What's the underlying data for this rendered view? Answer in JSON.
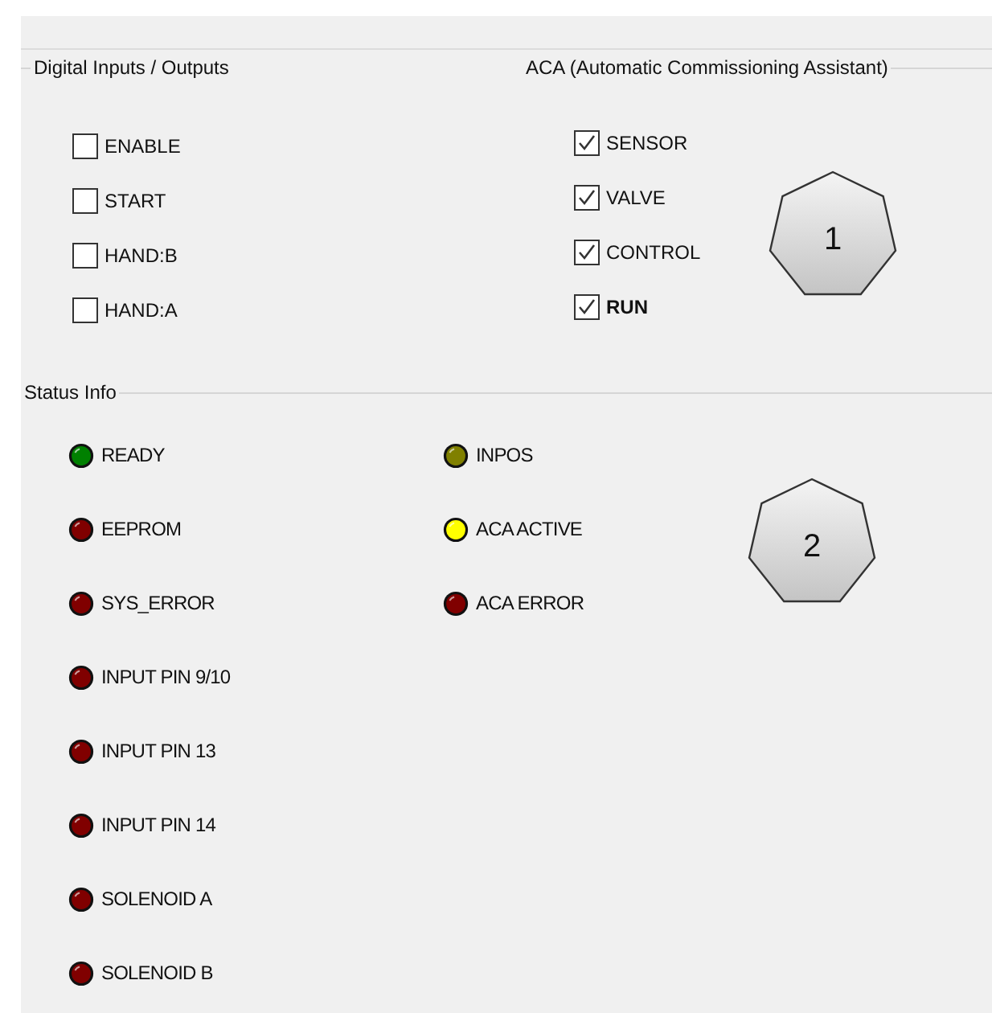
{
  "io_group": {
    "title": "Digital Inputs / Outputs",
    "items": [
      {
        "label": "ENABLE",
        "checked": false,
        "bold": false
      },
      {
        "label": "START",
        "checked": false,
        "bold": false
      },
      {
        "label": "HAND:B",
        "checked": false,
        "bold": false
      },
      {
        "label": "HAND:A",
        "checked": false,
        "bold": false
      }
    ]
  },
  "aca_group": {
    "title": "ACA (Automatic Commissioning Assistant)",
    "items": [
      {
        "label": "SENSOR",
        "checked": true,
        "bold": false
      },
      {
        "label": "VALVE",
        "checked": true,
        "bold": false
      },
      {
        "label": "CONTROL",
        "checked": true,
        "bold": false
      },
      {
        "label": "RUN",
        "checked": true,
        "bold": true
      }
    ],
    "callout": "1"
  },
  "status_info": {
    "title": "Status Info",
    "columns": [
      [
        {
          "label": "READY",
          "color": "#008000"
        },
        {
          "label": "EEPROM",
          "color": "#800000"
        },
        {
          "label": "SYS_ERROR",
          "color": "#800000"
        },
        {
          "label": "INPUT PIN 9/10",
          "color": "#800000"
        },
        {
          "label": "INPUT PIN 13",
          "color": "#800000"
        },
        {
          "label": "INPUT PIN 14",
          "color": "#800000"
        },
        {
          "label": "SOLENOID A",
          "color": "#800000"
        },
        {
          "label": "SOLENOID B",
          "color": "#800000"
        }
      ],
      [
        {
          "label": "INPOS",
          "color": "#808000"
        },
        {
          "label": "ACA ACTIVE",
          "color": "#ffff00"
        },
        {
          "label": "ACA ERROR",
          "color": "#800000"
        }
      ]
    ],
    "callout": "2"
  }
}
